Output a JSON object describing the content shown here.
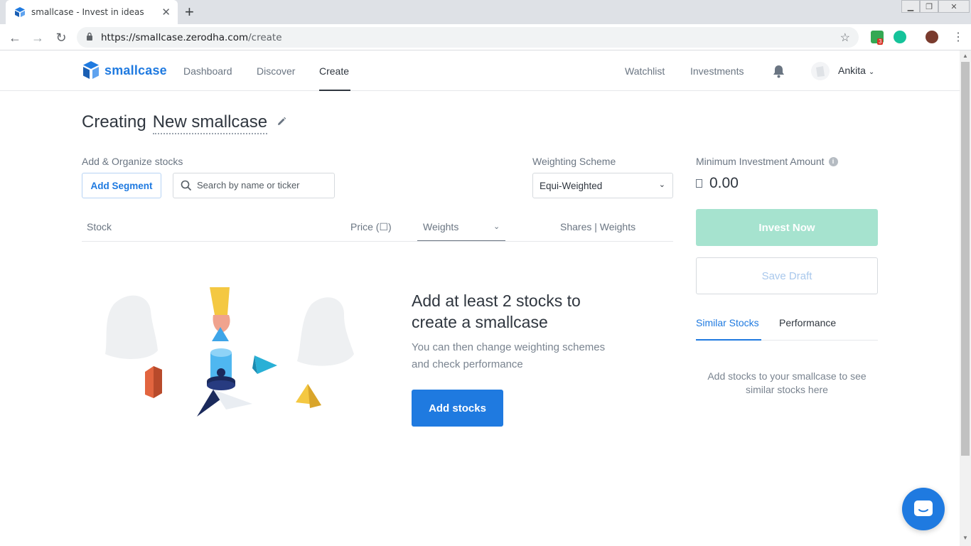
{
  "browser": {
    "tab_title": "smallcase - Invest in ideas",
    "url_host": "https://smallcase.zerodha.com",
    "url_path": "/create",
    "extension_badge": "3"
  },
  "header": {
    "brand": "smallcase",
    "nav": [
      "Dashboard",
      "Discover",
      "Create"
    ],
    "right_nav": [
      "Watchlist",
      "Investments"
    ],
    "user_name": "Ankita"
  },
  "page": {
    "title_prefix": "Creating",
    "smallcase_name": "New smallcase",
    "add_organize_label": "Add & Organize stocks",
    "add_segment_label": "Add Segment",
    "search_placeholder": "Search by name or ticker",
    "weighting_label": "Weighting Scheme",
    "weighting_value": "Equi-Weighted",
    "columns": {
      "stock": "Stock",
      "price": "Price (☐)",
      "weights": "Weights",
      "shares_weights": "Shares | Weights"
    },
    "empty_title": "Add at least 2 stocks to create a smallcase",
    "empty_subtitle": "You can then change weighting schemes and check performance",
    "add_stocks_label": "Add stocks"
  },
  "sidebar": {
    "min_investment_label": "Minimum Investment Amount",
    "min_investment_value": "0.00",
    "invest_now_label": "Invest Now",
    "save_draft_label": "Save Draft",
    "tabs": [
      "Similar Stocks",
      "Performance"
    ],
    "similar_hint": "Add stocks to your smallcase to see similar stocks here"
  },
  "colors": {
    "brand_blue": "#1f7ae0",
    "invest_disabled": "#a6e3cf",
    "text_primary": "#2f363f",
    "text_muted": "#6a7582"
  }
}
